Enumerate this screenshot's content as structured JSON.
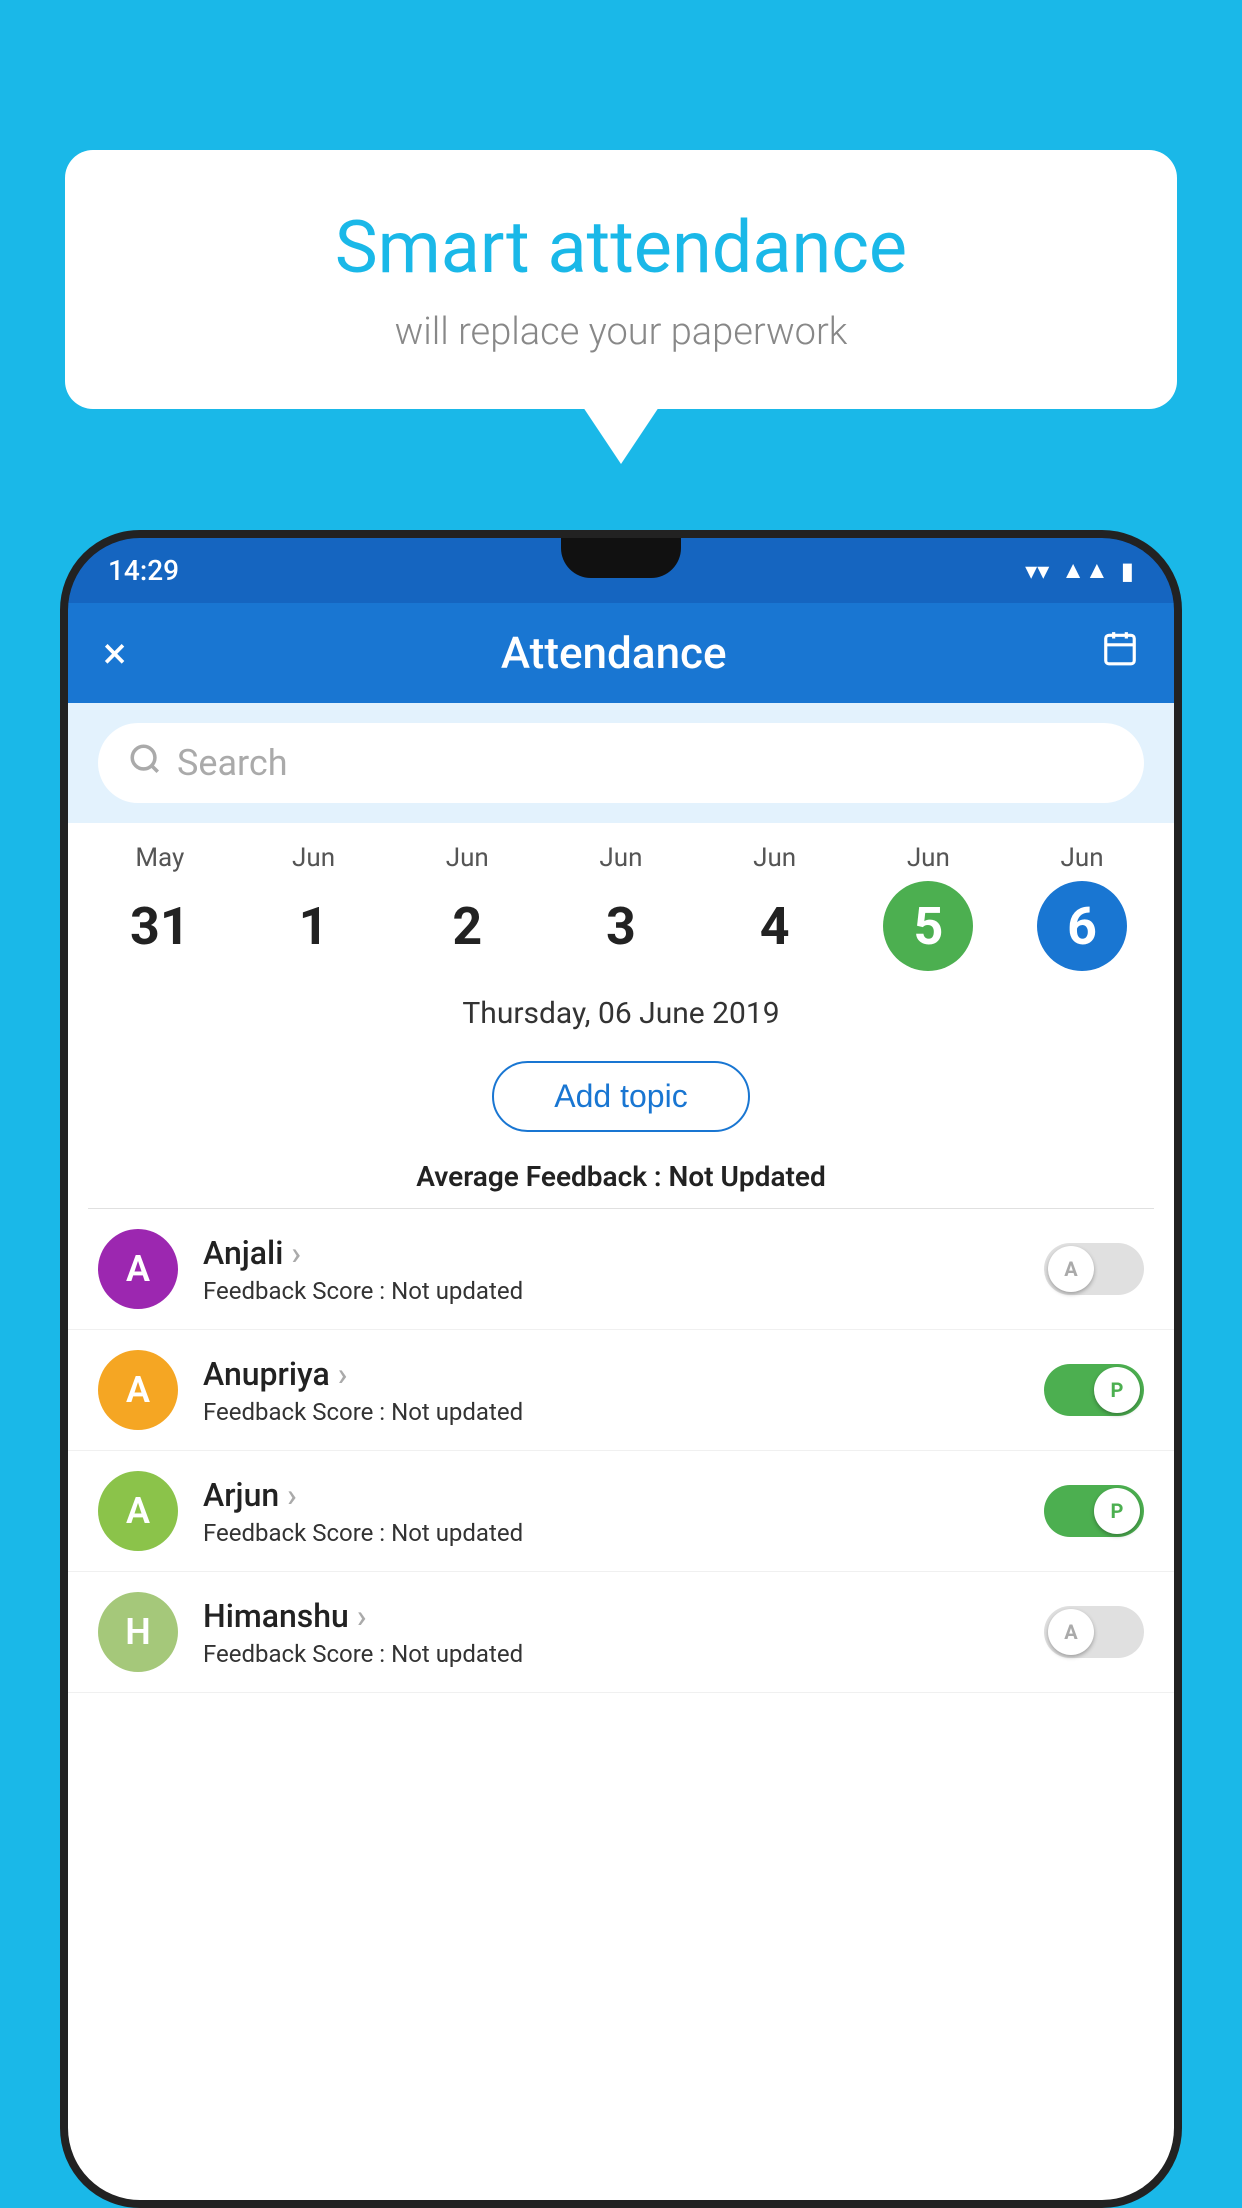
{
  "background_color": "#1ab8e8",
  "speech_bubble": {
    "title": "Smart attendance",
    "subtitle": "will replace your paperwork"
  },
  "status_bar": {
    "time": "14:29",
    "wifi_icon": "▼",
    "signal_icon": "▲",
    "battery_icon": "▮"
  },
  "app_bar": {
    "title": "Attendance",
    "close_label": "×",
    "calendar_icon": "📅"
  },
  "search": {
    "placeholder": "Search"
  },
  "calendar": {
    "days": [
      {
        "month": "May",
        "date": "31",
        "state": "normal"
      },
      {
        "month": "Jun",
        "date": "1",
        "state": "normal"
      },
      {
        "month": "Jun",
        "date": "2",
        "state": "normal"
      },
      {
        "month": "Jun",
        "date": "3",
        "state": "normal"
      },
      {
        "month": "Jun",
        "date": "4",
        "state": "normal"
      },
      {
        "month": "Jun",
        "date": "5",
        "state": "today"
      },
      {
        "month": "Jun",
        "date": "6",
        "state": "selected"
      }
    ]
  },
  "selected_date": "Thursday, 06 June 2019",
  "add_topic_label": "Add topic",
  "avg_feedback_label": "Average Feedback :",
  "avg_feedback_value": "Not Updated",
  "students": [
    {
      "name": "Anjali",
      "avatar_letter": "A",
      "avatar_color": "#9c27b0",
      "feedback_label": "Feedback Score :",
      "feedback_value": "Not updated",
      "attendance": "absent",
      "toggle_letter": "A"
    },
    {
      "name": "Anupriya",
      "avatar_letter": "A",
      "avatar_color": "#f5a623",
      "feedback_label": "Feedback Score :",
      "feedback_value": "Not updated",
      "attendance": "present",
      "toggle_letter": "P"
    },
    {
      "name": "Arjun",
      "avatar_letter": "A",
      "avatar_color": "#8bc34a",
      "feedback_label": "Feedback Score :",
      "feedback_value": "Not updated",
      "attendance": "present",
      "toggle_letter": "P"
    },
    {
      "name": "Himanshu",
      "avatar_letter": "H",
      "avatar_color": "#a5c87a",
      "feedback_label": "Feedback Score :",
      "feedback_value": "Not updated",
      "attendance": "absent",
      "toggle_letter": "A"
    }
  ]
}
